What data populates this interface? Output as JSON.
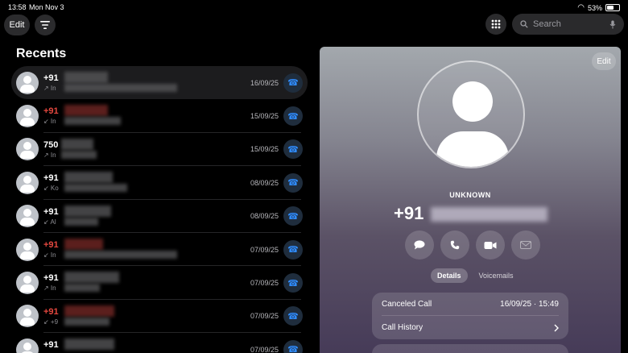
{
  "status_bar": {
    "time": "13:58",
    "date": "Mon Nov 3",
    "battery": "53%"
  },
  "toolbar": {
    "edit_label": "Edit",
    "filter_icon": "filter-icon",
    "keypad_icon": "keypad-icon"
  },
  "search": {
    "placeholder": "Search"
  },
  "recents": {
    "title": "Recents",
    "rows": [
      {
        "name": "+91",
        "sub": "↗ In",
        "date": "16/09/25",
        "missed": false,
        "selected": true
      },
      {
        "name": "+91",
        "sub": "↙ In",
        "date": "15/09/25",
        "missed": true,
        "selected": false
      },
      {
        "name": "750",
        "sub": "↗ In",
        "date": "15/09/25",
        "missed": false,
        "selected": false
      },
      {
        "name": "+91",
        "sub": "↙ Ko",
        "date": "08/09/25",
        "missed": false,
        "selected": false
      },
      {
        "name": "+91",
        "sub": "↙ Al",
        "date": "08/09/25",
        "missed": false,
        "selected": false
      },
      {
        "name": "+91",
        "sub": "↙ In",
        "date": "07/09/25",
        "missed": true,
        "selected": false
      },
      {
        "name": "+91",
        "sub": "↗ In",
        "date": "07/09/25",
        "missed": false,
        "selected": false
      },
      {
        "name": "+91",
        "sub": "↙ +9",
        "date": "07/09/25",
        "missed": true,
        "selected": false
      },
      {
        "name": "+91",
        "sub": "",
        "date": "07/09/25",
        "missed": false,
        "selected": false
      }
    ]
  },
  "detail": {
    "edit_label": "Edit",
    "caller_label": "UNKNOWN",
    "number_prefix": "+91",
    "tabs": {
      "details": "Details",
      "voicemails": "Voicemails"
    },
    "call_status": "Canceled Call",
    "call_time": "16/09/25 · 15:49",
    "call_history": "Call History"
  }
}
